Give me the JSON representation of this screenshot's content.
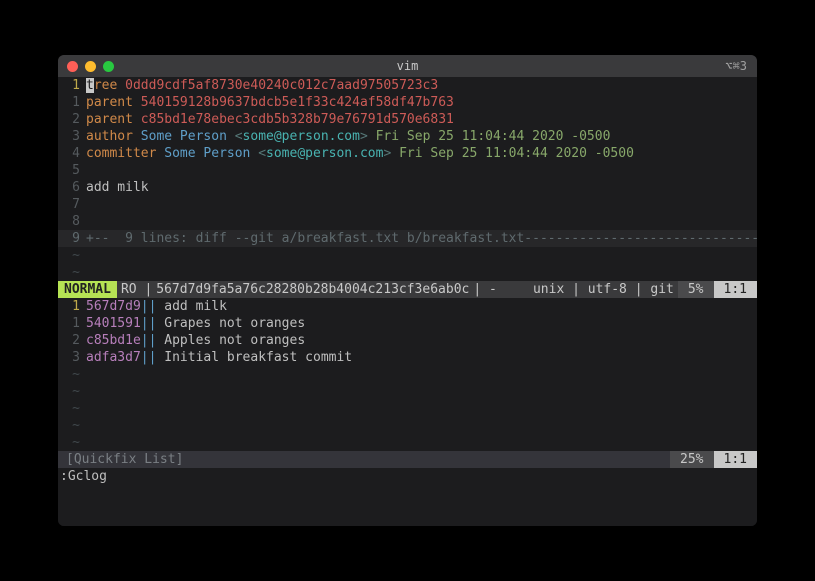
{
  "titlebar": {
    "title": "vim",
    "right": "⌥⌘3"
  },
  "top_pane": {
    "lines": [
      {
        "ln": "1",
        "current": true,
        "type": "tree",
        "cursor": "t",
        "rest": "ree ",
        "hash": "0ddd9cdf5af8730e40240c012c7aad97505723c3"
      },
      {
        "ln": "1",
        "type": "parent",
        "kw": "parent ",
        "hash": "540159128b9637bdcb5e1f33c424af58df47b763"
      },
      {
        "ln": "2",
        "type": "parent",
        "kw": "parent ",
        "hash": "c85bd1e78ebec3cdb5b328b79e76791d570e6831"
      },
      {
        "ln": "3",
        "type": "author",
        "kw": "author ",
        "name": "Some Person ",
        "lt": "<",
        "email": "some@person.com",
        "gt": "> ",
        "date": "Fri Sep 25 11:04:44 2020 -0500"
      },
      {
        "ln": "4",
        "type": "committer",
        "kw": "committer ",
        "name": "Some Person ",
        "lt": "<",
        "email": "some@person.com",
        "gt": "> ",
        "date": "Fri Sep 25 11:04:44 2020 -0500"
      },
      {
        "ln": "5",
        "type": "blank"
      },
      {
        "ln": "6",
        "type": "text",
        "text": "add milk"
      },
      {
        "ln": "7",
        "type": "blank"
      },
      {
        "ln": "8",
        "type": "blank"
      },
      {
        "ln": "9",
        "type": "fold",
        "text": "+--  9 lines: diff --git a/breakfast.txt b/breakfast.txt----------------------------------------"
      }
    ],
    "tildes": 2
  },
  "statusline": {
    "mode": "NORMAL",
    "ro_sep": " RO | ",
    "file": "567d7d9fa5a76c28280b28b4004c213cf3e6ab0c",
    "trail": " | -",
    "right1": "unix | utf-8 | git ",
    "pct": "5%",
    "pos": "1:1"
  },
  "log_pane": {
    "lines": [
      {
        "ln": "1",
        "current": true,
        "hash": "567d7d9",
        "sep": "|| ",
        "msg": "add milk"
      },
      {
        "ln": "1",
        "hash": "5401591",
        "sep": "|| ",
        "msg": "Grapes not oranges"
      },
      {
        "ln": "2",
        "hash": "c85bd1e",
        "sep": "|| ",
        "msg": "Apples not oranges"
      },
      {
        "ln": "3",
        "hash": "adfa3d7",
        "sep": "|| ",
        "msg": "Initial breakfast commit"
      }
    ],
    "tildes": 5
  },
  "statusline2": {
    "title": "[Quickfix List]",
    "pct": "25%",
    "pos": "1:1"
  },
  "cmdline": ":Gclog"
}
